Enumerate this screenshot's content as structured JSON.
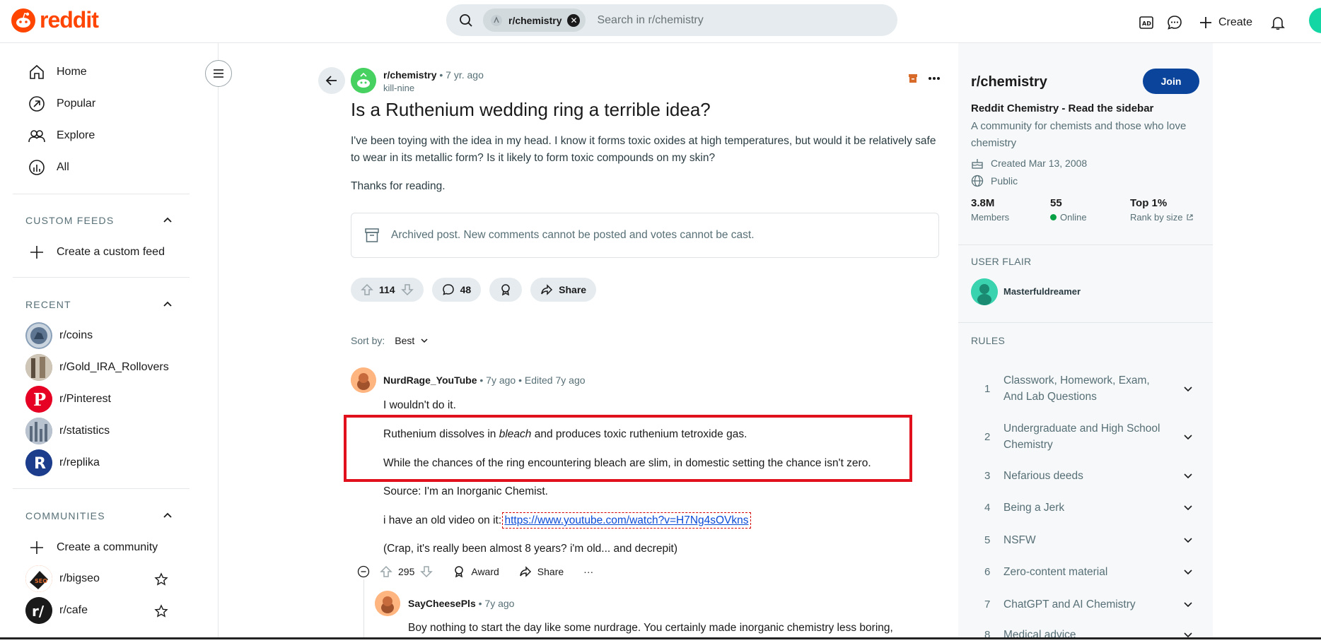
{
  "header": {
    "logo_text": "reddit",
    "search_chip": "r/chemistry",
    "search_placeholder": "Search in r/chemistry",
    "create_label": "Create"
  },
  "sidebar": {
    "nav": [
      {
        "label": "Home",
        "icon": "home-icon"
      },
      {
        "label": "Popular",
        "icon": "popular-icon"
      },
      {
        "label": "Explore",
        "icon": "explore-icon"
      },
      {
        "label": "All",
        "icon": "all-icon"
      }
    ],
    "custom_feeds_title": "CUSTOM FEEDS",
    "create_feed": "Create a custom feed",
    "recent_title": "RECENT",
    "recent": [
      {
        "label": "r/coins",
        "color": "#8aa0b8"
      },
      {
        "label": "r/Gold_IRA_Rollovers",
        "color": "#8b7d6b"
      },
      {
        "label": "r/Pinterest",
        "color": "#e60023"
      },
      {
        "label": "r/statistics",
        "color": "#7f8fa6"
      },
      {
        "label": "r/replika",
        "color": "#1c3d8c"
      }
    ],
    "communities_title": "COMMUNITIES",
    "create_community": "Create a community",
    "communities": [
      {
        "label": "r/bigseo",
        "color": "#e36b2c"
      },
      {
        "label": "r/cafe",
        "color": "#1a1a1b"
      }
    ]
  },
  "post": {
    "subreddit": "r/chemistry",
    "age": "• 7 yr. ago",
    "author": "kill-nine",
    "title": "Is a Ruthenium wedding ring a terrible idea?",
    "body": [
      "I've been toying with the idea in my head. I know it forms toxic oxides at high temperatures, but would it be relatively safe to wear in its metallic form? Is it likely to form toxic compounds on my skin?",
      "Thanks for reading."
    ],
    "archived_notice": "Archived post. New comments cannot be posted and votes cannot be cast.",
    "votes": "114",
    "comments": "48",
    "share_label": "Share",
    "sort_label": "Sort by:",
    "sort_value": "Best"
  },
  "comment": {
    "author": "NurdRage_YouTube",
    "age": "• 7y ago",
    "edited": "• Edited 7y ago",
    "lines": {
      "l1": "I wouldn't do it.",
      "l2a": "Ruthenium dissolves in ",
      "l2b": "bleach",
      "l2c": " and produces toxic ruthenium tetroxide gas.",
      "l3": "While the chances of the ring encountering bleach are slim, in domestic setting the chance isn't zero.",
      "l4": "Source: I'm an Inorganic Chemist.",
      "l5": "i have an old video on it: ",
      "link": "https://www.youtube.com/watch?v=H7Ng4sOVkns",
      "l6": "(Crap, it's really been almost 8 years? i'm old... and decrepit)"
    },
    "votes": "295",
    "award_label": "Award",
    "share_label": "Share",
    "more": "···"
  },
  "reply": {
    "author": "SayCheesePls",
    "age": "• 7y ago",
    "text": "Boy nothing to start the day like some nurdrage. You certainly made inorganic chemistry less boring,"
  },
  "right": {
    "title": "r/chemistry",
    "join_label": "Join",
    "subtitle": "Reddit Chemistry - Read the sidebar",
    "description": "A community for chemists and those who love chemistry",
    "created": "Created Mar 13, 2008",
    "visibility": "Public",
    "members_value": "3.8M",
    "members_label": "Members",
    "online_value": "55",
    "online_label": "Online",
    "rank_value": "Top 1%",
    "rank_label": "Rank by size",
    "user_flair_title": "USER FLAIR",
    "flair_user": "Masterfuldreamer",
    "rules_title": "RULES",
    "rules": [
      {
        "n": "1",
        "t": "Classwork, Homework, Exam, And Lab Questions"
      },
      {
        "n": "2",
        "t": "Undergraduate and High School Chemistry"
      },
      {
        "n": "3",
        "t": "Nefarious deeds"
      },
      {
        "n": "4",
        "t": "Being a Jerk"
      },
      {
        "n": "5",
        "t": "NSFW"
      },
      {
        "n": "6",
        "t": "Zero-content material"
      },
      {
        "n": "7",
        "t": "ChatGPT and AI Chemistry"
      },
      {
        "n": "8",
        "t": "Medical advice"
      }
    ]
  },
  "colors": {
    "brand": "#ff4500",
    "join": "#0a449b",
    "highlight": "#e0111c",
    "online": "#08a045"
  }
}
